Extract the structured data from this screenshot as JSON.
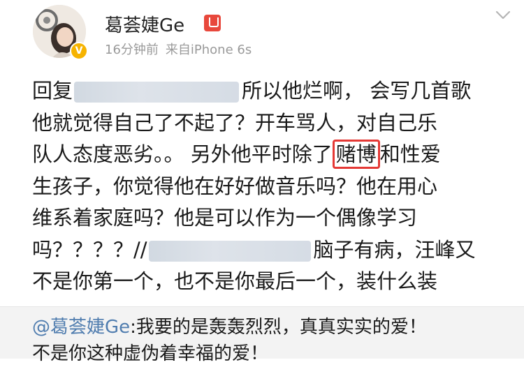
{
  "post": {
    "author": {
      "name": "葛荟婕Ge",
      "time": "16分钟前",
      "source": "来自iPhone 6s"
    },
    "body": {
      "line1_prefix": "回复",
      "line1_suffix": "所以他烂啊， 会写几首歌",
      "line2": "他就觉得自己了不起了？开车骂人，对自己乐",
      "line3_prefix": "队人态度恶劣。。 另外他平时除了",
      "line3_highlight": "赌博",
      "line3_suffix": "和性爱",
      "line4": "生孩子，你觉得他在好好做音乐吗？他在用心",
      "line5": "维系着家庭吗？他是可以作为一个偶像学习",
      "line6_prefix": "吗？？？？//",
      "line6_suffix": "脑子有病，汪峰又",
      "line7": "不是你第一个，也不是你最后一个，装什么装"
    },
    "repost": {
      "mention": "@葛荟婕Ge",
      "line1": ":我要的是轰轰烈烈，真真实实的爱！",
      "line2": "不是你这种虚伪着幸福的爱！"
    }
  }
}
